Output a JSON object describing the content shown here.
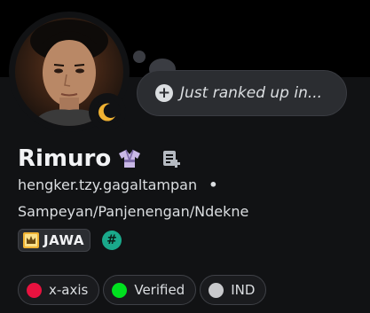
{
  "profile": {
    "display_name": "Rimuro",
    "username": "hengker.tzy.gagaltampan",
    "separator": "•",
    "pronouns": "Sampeyan/Panjenengan/Ndekne",
    "status_icon": "moon-icon",
    "name_badge_icon": "kimono-icon",
    "notes_icon": "note-add-icon"
  },
  "custom_status": {
    "text": "Just ranked up in...",
    "icon": "plus-icon"
  },
  "guild_tag": {
    "text": "JAWA",
    "badge_icon": "crown-shield-icon",
    "accent": "#f0b232"
  },
  "hash_badge": {
    "symbol": "#",
    "color": "#1aa98b"
  },
  "roles": [
    {
      "label": "x-axis",
      "color": "#e8123f"
    },
    {
      "label": "Verified",
      "color": "#00e01f"
    },
    {
      "label": "IND",
      "color": "#c8c9cc"
    }
  ],
  "colors": {
    "background": "#111214",
    "banner": "#000000",
    "bubble": "#2b2d31",
    "moon": "#f0b232"
  }
}
